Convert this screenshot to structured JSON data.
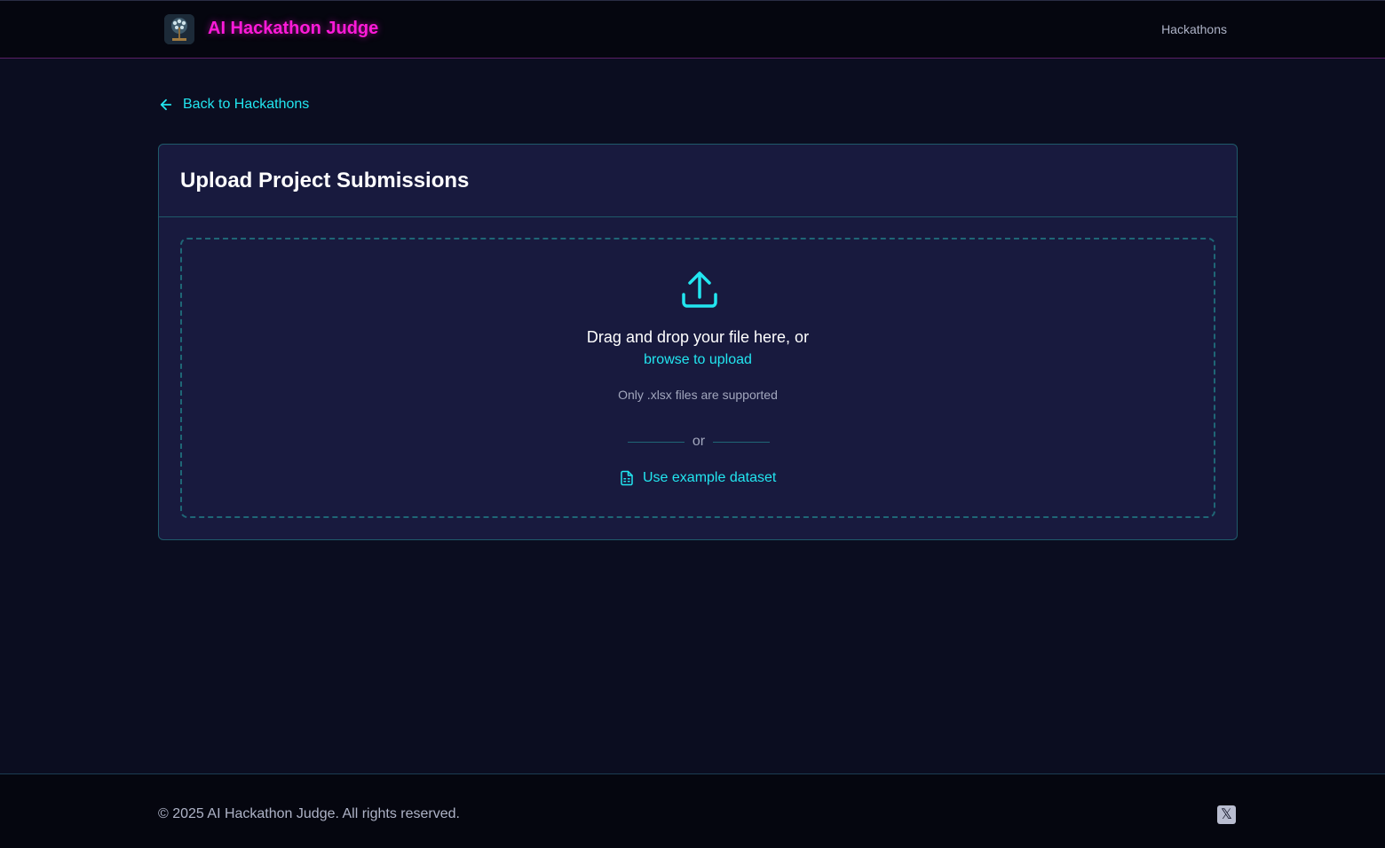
{
  "header": {
    "logo_icon": "ai-tree-logo-icon",
    "brand": "AI Hackathon Judge",
    "nav": [
      {
        "label": "Hackathons"
      }
    ]
  },
  "back_link": {
    "icon": "arrow-left-icon",
    "label": "Back to Hackathons"
  },
  "card": {
    "title": "Upload Project Submissions",
    "dropzone": {
      "icon": "upload-icon",
      "prompt": "Drag and drop your file here, or",
      "browse_label": "browse to upload",
      "support_text": "Only .xlsx files are supported",
      "divider_label": "or",
      "example_icon": "file-spreadsheet-icon",
      "example_label": "Use example dataset"
    }
  },
  "footer": {
    "copyright": "© 2025 AI Hackathon Judge. All rights reserved.",
    "social_icon": "x-logo-icon",
    "social_glyph": "𝕏"
  },
  "colors": {
    "background": "#0b0d20",
    "header_bg": "#05060f",
    "card_bg": "#181a3e",
    "border": "#1f5a6a",
    "accent_cyan": "#22e6f0",
    "brand_magenta": "#ff1ad9",
    "muted_text": "#a2a7bd"
  }
}
